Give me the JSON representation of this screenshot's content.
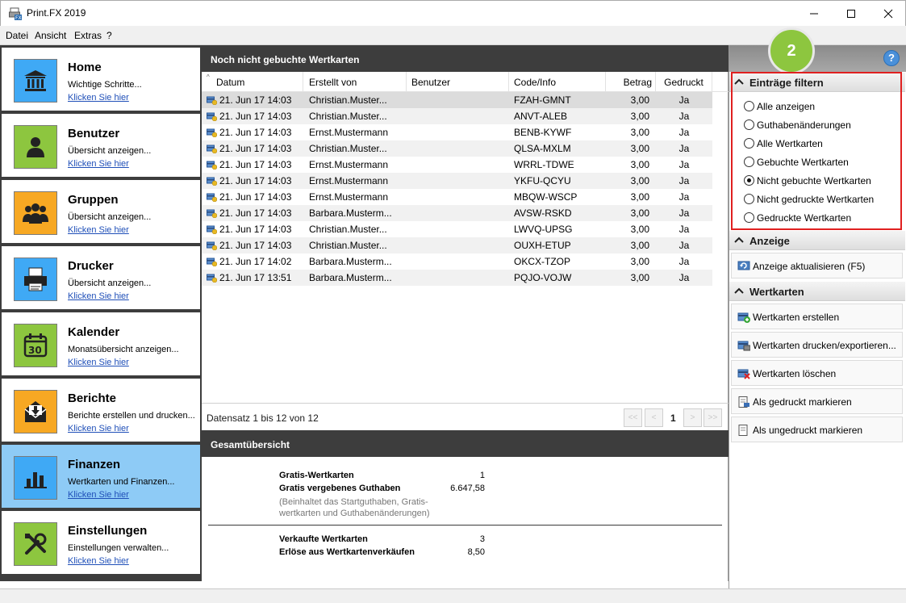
{
  "window": {
    "title": "Print.FX 2019"
  },
  "menu": [
    "Datei",
    "Ansicht",
    "Extras",
    "?"
  ],
  "nav": [
    {
      "title": "Home",
      "subtitle": "Wichtige Schritte...",
      "link": "Klicken Sie hier",
      "icon": "bank-icon",
      "color": "#3fa9f5"
    },
    {
      "title": "Benutzer",
      "subtitle": "Übersicht anzeigen...",
      "link": "Klicken Sie hier",
      "icon": "user-icon",
      "color": "#8dc63f"
    },
    {
      "title": "Gruppen",
      "subtitle": "Übersicht anzeigen...",
      "link": "Klicken Sie hier",
      "icon": "group-icon",
      "color": "#f7a823"
    },
    {
      "title": "Drucker",
      "subtitle": "Übersicht anzeigen...",
      "link": "Klicken Sie hier",
      "icon": "printer-icon",
      "color": "#3fa9f5"
    },
    {
      "title": "Kalender",
      "subtitle": "Monatsübersicht anzeigen...",
      "link": "Klicken Sie hier",
      "icon": "calendar-icon",
      "color": "#8dc63f"
    },
    {
      "title": "Berichte",
      "subtitle": "Berichte erstellen und drucken...",
      "link": "Klicken Sie hier",
      "icon": "report-icon",
      "color": "#f7a823"
    },
    {
      "title": "Finanzen",
      "subtitle": "Wertkarten und Finanzen...",
      "link": "Klicken Sie hier",
      "icon": "chart-icon",
      "color": "#3fa9f5"
    },
    {
      "title": "Einstellungen",
      "subtitle": "Einstellungen verwalten...",
      "link": "Klicken Sie hier",
      "icon": "tools-icon",
      "color": "#8dc63f"
    }
  ],
  "main": {
    "header": "Noch nicht gebuchte Wertkarten",
    "columns": [
      "Datum",
      "Erstellt von",
      "Benutzer",
      "Code/Info",
      "Betrag",
      "Gedruckt"
    ],
    "rows": [
      {
        "date": "21. Jun 17 14:03",
        "creator": "Christian.Muster...",
        "user": "",
        "code": "FZAH-GMNT",
        "amount": "3,00",
        "printed": "Ja"
      },
      {
        "date": "21. Jun 17 14:03",
        "creator": "Christian.Muster...",
        "user": "",
        "code": "ANVT-ALEB",
        "amount": "3,00",
        "printed": "Ja"
      },
      {
        "date": "21. Jun 17 14:03",
        "creator": "Ernst.Mustermann",
        "user": "",
        "code": "BENB-KYWF",
        "amount": "3,00",
        "printed": "Ja"
      },
      {
        "date": "21. Jun 17 14:03",
        "creator": "Christian.Muster...",
        "user": "",
        "code": "QLSA-MXLM",
        "amount": "3,00",
        "printed": "Ja"
      },
      {
        "date": "21. Jun 17 14:03",
        "creator": "Ernst.Mustermann",
        "user": "",
        "code": "WRRL-TDWE",
        "amount": "3,00",
        "printed": "Ja"
      },
      {
        "date": "21. Jun 17 14:03",
        "creator": "Ernst.Mustermann",
        "user": "",
        "code": "YKFU-QCYU",
        "amount": "3,00",
        "printed": "Ja"
      },
      {
        "date": "21. Jun 17 14:03",
        "creator": "Ernst.Mustermann",
        "user": "",
        "code": "MBQW-WSCP",
        "amount": "3,00",
        "printed": "Ja"
      },
      {
        "date": "21. Jun 17 14:03",
        "creator": "Barbara.Musterm...",
        "user": "",
        "code": "AVSW-RSKD",
        "amount": "3,00",
        "printed": "Ja"
      },
      {
        "date": "21. Jun 17 14:03",
        "creator": "Christian.Muster...",
        "user": "",
        "code": "LWVQ-UPSG",
        "amount": "3,00",
        "printed": "Ja"
      },
      {
        "date": "21. Jun 17 14:03",
        "creator": "Christian.Muster...",
        "user": "",
        "code": "OUXH-ETUP",
        "amount": "3,00",
        "printed": "Ja"
      },
      {
        "date": "21. Jun 17 14:02",
        "creator": "Barbara.Musterm...",
        "user": "",
        "code": "OKCX-TZOP",
        "amount": "3,00",
        "printed": "Ja"
      },
      {
        "date": "21. Jun 17 13:51",
        "creator": "Barbara.Musterm...",
        "user": "",
        "code": "PQJO-VOJW",
        "amount": "3,00",
        "printed": "Ja"
      }
    ],
    "record_count": "Datensatz 1 bis 12 von 12",
    "page": "1",
    "pager": {
      "first": "<<",
      "prev": "<",
      "next": ">",
      "last": ">>"
    }
  },
  "summary": {
    "header": "Gesamtübersicht",
    "free_cards_label": "Gratis-Wertkarten",
    "free_cards_value": "1",
    "free_credit_label": "Gratis vergebenes Guthaben",
    "free_credit_value": "6.647,58",
    "note": "(Beinhaltet das Startguthaben, Gratis-wertkarten und Guthabenänderungen)",
    "sold_cards_label": "Verkaufte Wertkarten",
    "sold_cards_value": "3",
    "revenue_label": "Erlöse aus Wertkartenverkäufen",
    "revenue_value": "8,50"
  },
  "right": {
    "badge": "2",
    "help": "?",
    "filter_title": "Einträge filtern",
    "filters": [
      {
        "label": "Alle anzeigen",
        "checked": false
      },
      {
        "label": "Guthabenänderungen",
        "checked": false
      },
      {
        "label": "Alle Wertkarten",
        "checked": false
      },
      {
        "label": "Gebuchte Wertkarten",
        "checked": false
      },
      {
        "label": "Nicht gebuchte Wertkarten",
        "checked": true
      },
      {
        "label": "Nicht gedruckte Wertkarten",
        "checked": false
      },
      {
        "label": "Gedruckte Wertkarten",
        "checked": false
      }
    ],
    "display_title": "Anzeige",
    "refresh_label": "Anzeige aktualisieren (F5)",
    "cards_title": "Wertkarten",
    "actions": [
      {
        "label": "Wertkarten erstellen",
        "icon": "card-add-icon"
      },
      {
        "label": "Wertkarten drucken/exportieren...",
        "icon": "card-print-icon"
      },
      {
        "label": "Wertkarten löschen",
        "icon": "card-delete-icon"
      },
      {
        "label": "Als gedruckt markieren",
        "icon": "mark-printed-icon"
      },
      {
        "label": "Als ungedruckt markieren",
        "icon": "mark-unprinted-icon"
      }
    ]
  }
}
